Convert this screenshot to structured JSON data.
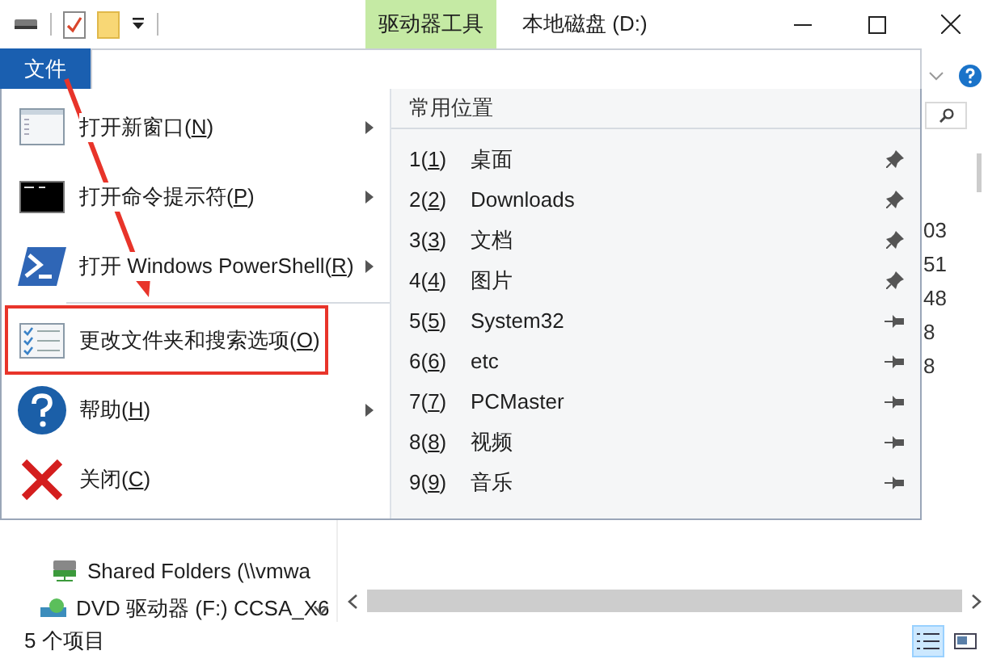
{
  "title_bar": {
    "context_tab": "驱动器工具",
    "title": "本地磁盘 (D:)"
  },
  "ribbon": {
    "file_tab": {
      "label": "文件",
      "selected": true
    }
  },
  "file_menu": {
    "items": [
      {
        "kind": "new-window",
        "before": "打开新窗口(",
        "key": "N",
        "after": ")",
        "has_submenu": true,
        "highlighted": false
      },
      {
        "kind": "command-prompt",
        "before": "打开命令提示符(",
        "key": "P",
        "after": ")",
        "has_submenu": true,
        "highlighted": false
      },
      {
        "kind": "powershell",
        "before": "打开 Windows PowerShell(",
        "key": "R",
        "after": ")",
        "has_submenu": true,
        "highlighted": false
      },
      {
        "kind": "folder-options",
        "before": "更改文件夹和搜索选项(",
        "key": "O",
        "after": ")",
        "has_submenu": false,
        "highlighted": true
      },
      {
        "kind": "help",
        "before": "帮助(",
        "key": "H",
        "after": ")",
        "has_submenu": true,
        "highlighted": false
      },
      {
        "kind": "close",
        "before": "关闭(",
        "key": "C",
        "after": ")",
        "has_submenu": false,
        "highlighted": false
      }
    ],
    "places_header": "常用位置",
    "places": [
      {
        "before": "1(",
        "key": "1",
        "after": ")",
        "name": "桌面",
        "pinned": true
      },
      {
        "before": "2(",
        "key": "2",
        "after": ")",
        "name": "Downloads",
        "pinned": true
      },
      {
        "before": "3(",
        "key": "3",
        "after": ")",
        "name": "文档",
        "pinned": true
      },
      {
        "before": "4(",
        "key": "4",
        "after": ")",
        "name": "图片",
        "pinned": true
      },
      {
        "before": "5(",
        "key": "5",
        "after": ")",
        "name": "System32",
        "pinned": false
      },
      {
        "before": "6(",
        "key": "6",
        "after": ")",
        "name": "etc",
        "pinned": false
      },
      {
        "before": "7(",
        "key": "7",
        "after": ")",
        "name": "PCMaster",
        "pinned": false
      },
      {
        "before": "8(",
        "key": "8",
        "after": ")",
        "name": "视频",
        "pinned": false
      },
      {
        "before": "9(",
        "key": "9",
        "after": ")",
        "name": "音乐",
        "pinned": false
      }
    ]
  },
  "file_list_cells": [
    "03",
    "51",
    "48",
    "8",
    "8"
  ],
  "navigation": [
    {
      "kind": "network-drive",
      "label": "Shared Folders (\\\\vmwa"
    },
    {
      "kind": "dvd-drive",
      "label": "DVD 驱动器 (F:) CCSA_X6"
    }
  ],
  "status_bar": {
    "item_count": "5 个项目"
  }
}
